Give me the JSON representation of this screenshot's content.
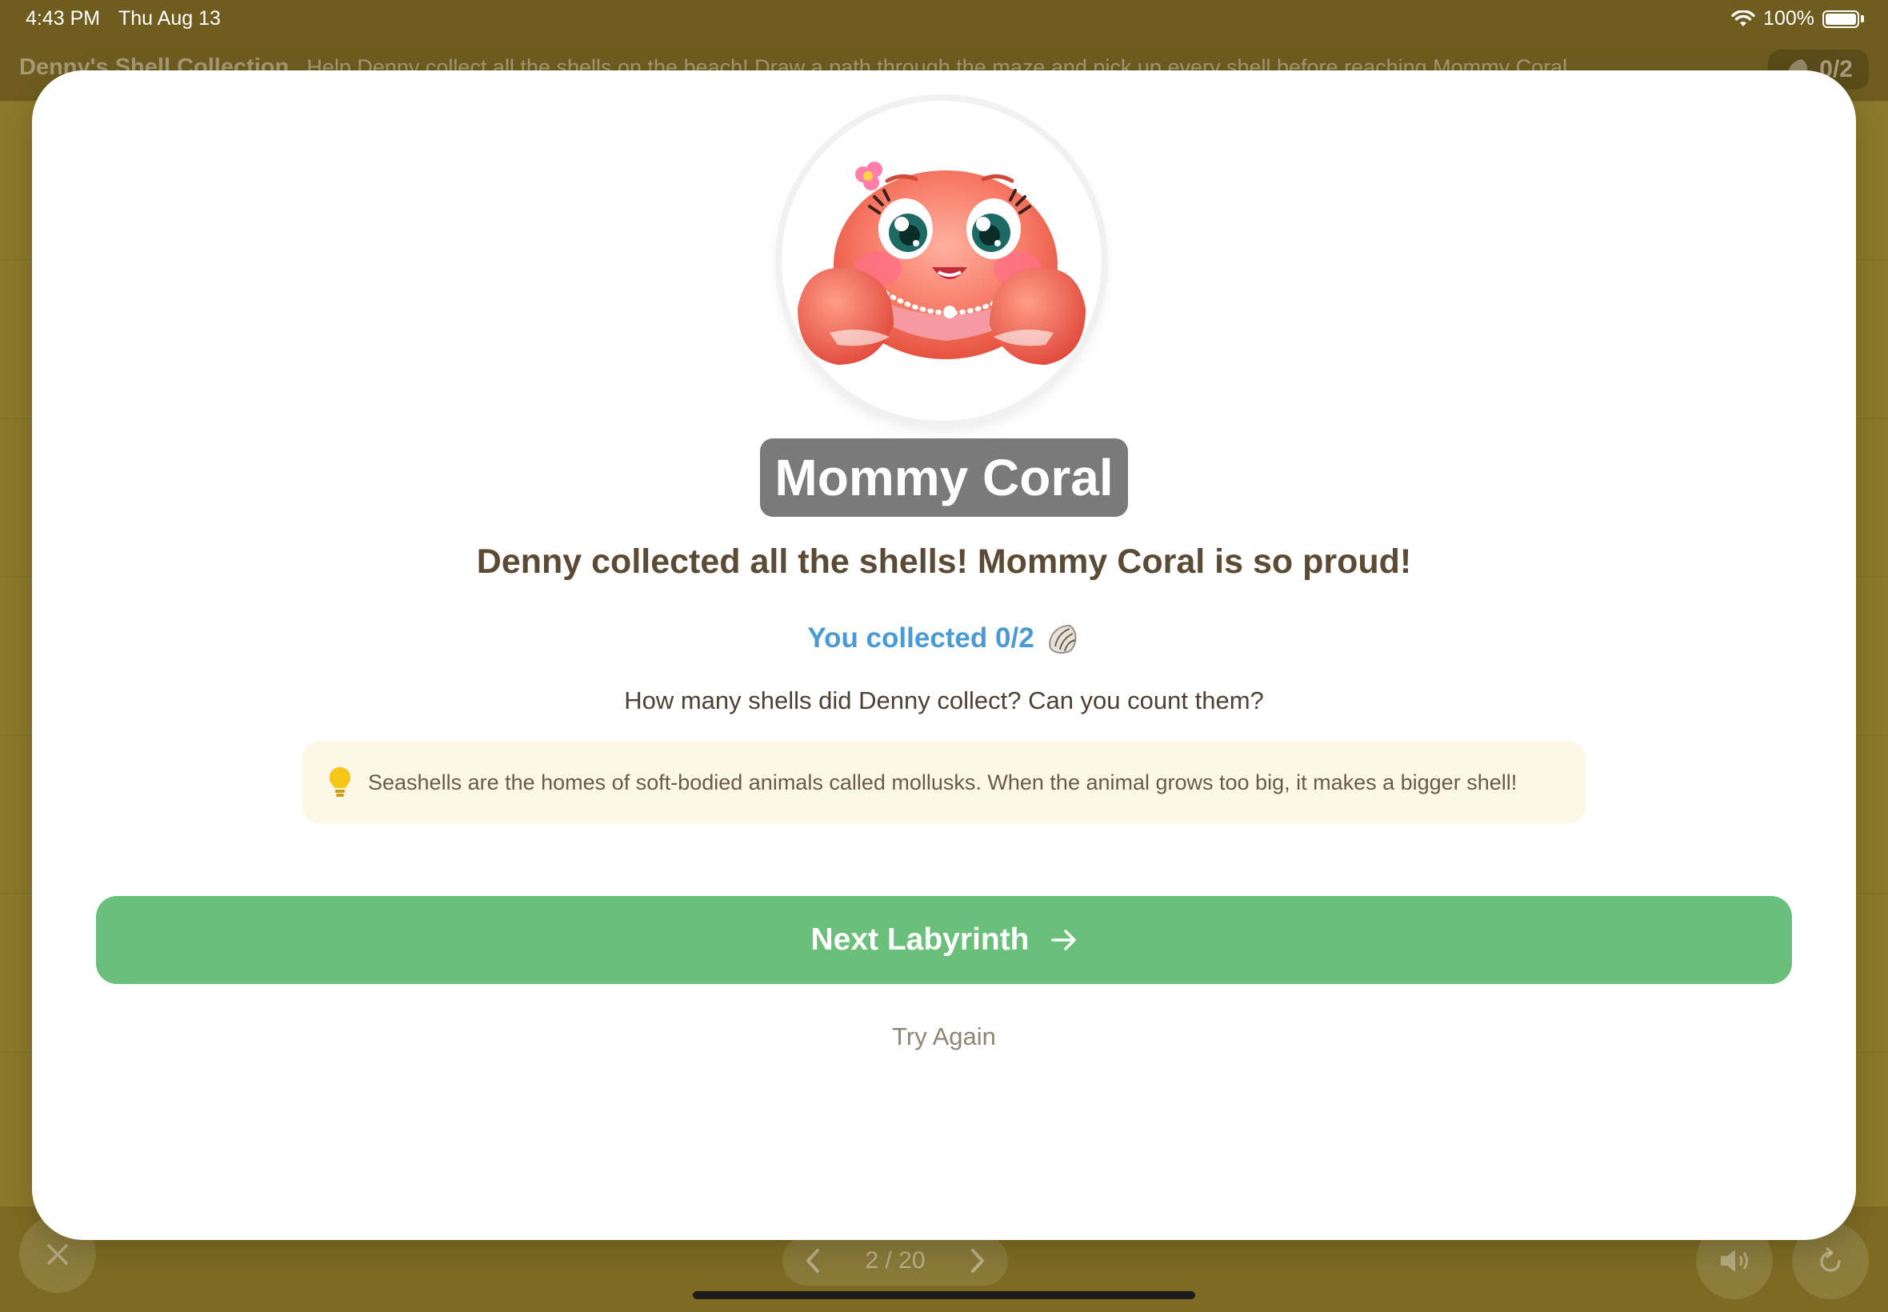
{
  "status_bar": {
    "time": "4:43 PM",
    "date": "Thu Aug 13",
    "battery": "100%",
    "wifi_icon": "wifi-icon",
    "battery_icon": "battery-icon"
  },
  "game": {
    "title": "Denny's Shell Collection",
    "subtitle": "Help Denny collect all the shells on the beach! Draw a path through the maze and pick up every shell before reaching Mommy Coral.",
    "score": "0/2",
    "pager": "2 / 20"
  },
  "modal": {
    "character_name": "Mommy Coral",
    "headline": "Denny collected all the shells! Mommy Coral is so proud!",
    "collected_text": "You collected 0/2",
    "question": "How many shells did Denny collect? Can you count them?",
    "fact": "Seashells are the homes of soft-bodied animals called mollusks. When the animal grows too big, it makes a bigger shell!",
    "next_label": "Next Labyrinth",
    "try_again_label": "Try Again"
  },
  "colors": {
    "primary_green": "#6abf7a",
    "collected_blue": "#4a9bd4",
    "headline_brown": "#5b4a34",
    "badge_gray": "#7a7a7a",
    "fact_bg": "#fdf7e8"
  }
}
